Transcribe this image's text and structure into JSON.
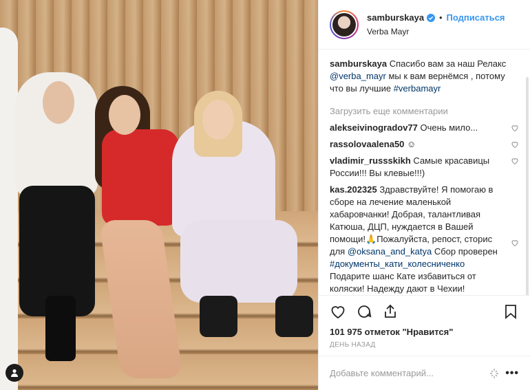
{
  "post": {
    "username": "samburskaya",
    "follow_label": "Подписаться",
    "location": "Verba Mayr",
    "dot": "•",
    "caption": {
      "username": "samburskaya",
      "text_1": "Спасибо вам за наш Релакс",
      "mention": "@verba_mayr",
      "text_2": "мы к вам вернёмся , потому что вы лучшие",
      "hashtag": "#verbamayr"
    },
    "load_more": "Загрузить еще комментарии",
    "comments": [
      {
        "user": "alekseivinogradov77",
        "text": "Очень мило..."
      },
      {
        "user": "rassolovaalena50",
        "text": "☺"
      },
      {
        "user": "vladimir_russskikh",
        "text": "Самые красавицы России!!! Вы клевые!!!)"
      }
    ],
    "long_comment": {
      "user": "kas.202325",
      "text_1": "Здравствуйте! Я помогаю в сборе на лечение маленькой хабаровчанки! Добрая, талантливая Катюша, ДЦП, нуждается в Вашей помощи!🙏Пожалуйста, репост, сторис для",
      "mention": "@oksana_and_katya",
      "text_2": "Сбор проверен",
      "hashtag": "#документы_кати_колесниченко",
      "text_3": "Подарите шанс Кате избавиться от коляски! Надежду дают в Чехии!"
    },
    "likes": "101 975 отметок \"Нравится\"",
    "time": "ДЕНЬ НАЗАД",
    "add_comment_placeholder": "Добавьте комментарий...",
    "more_label": "•••"
  },
  "icons": {
    "heart": "heart-icon",
    "comment": "comment-icon",
    "share": "share-icon",
    "bookmark": "bookmark-icon",
    "verified": "verified-badge-icon",
    "user_tag": "user-tag-icon"
  },
  "colors": {
    "link": "#003569",
    "follow": "#3897f0",
    "muted": "#999999"
  }
}
